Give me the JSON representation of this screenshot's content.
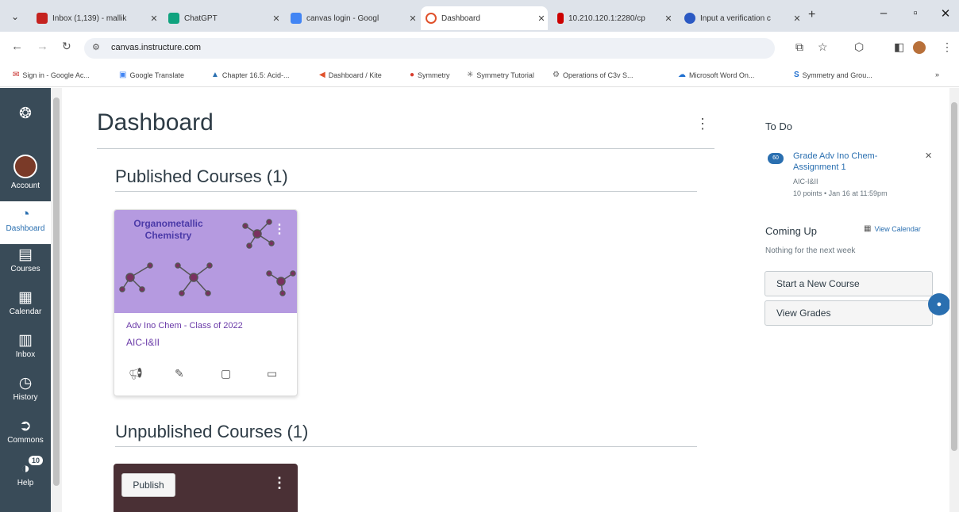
{
  "browser": {
    "tabs": [
      {
        "label": "Inbox (1,139) - mallik",
        "color": "#c5221f"
      },
      {
        "label": "ChatGPT",
        "color": "#10a37f"
      },
      {
        "label": "canvas login - Googl",
        "color": "#4285f4"
      },
      {
        "label": "Dashboard",
        "color": "#e0512b"
      },
      {
        "label": "10.210.120.1:2280/cp",
        "color": "#c00"
      },
      {
        "label": "Input a verification c",
        "color": "#2b59c3"
      }
    ],
    "new_tab": "+",
    "url": "canvas.instructure.com",
    "bookmarks": [
      "Sign in - Google Ac...",
      "Google Translate",
      "Chapter 16.5: Acid-...",
      "Dashboard / Kite",
      "Symmetry",
      "Symmetry Tutorial",
      "Operations of C3v S...",
      "Microsoft Word On...",
      "Symmetry and Grou..."
    ],
    "more_bookmarks": "»"
  },
  "global_nav": {
    "items": [
      {
        "label": "Account"
      },
      {
        "label": "Dashboard"
      },
      {
        "label": "Courses"
      },
      {
        "label": "Calendar"
      },
      {
        "label": "Inbox"
      },
      {
        "label": "History"
      },
      {
        "label": "Commons"
      },
      {
        "label": "Help",
        "badge": "10"
      }
    ]
  },
  "main": {
    "title": "Dashboard",
    "published_heading": "Published Courses (1)",
    "unpublished_heading": "Unpublished Courses (1)",
    "course_card": {
      "image_text": "Organometallic Chemistry",
      "title": "Adv Ino Chem - Class of 2022",
      "code": "AIC-I&II"
    },
    "unpublished_card": {
      "publish_label": "Publish"
    }
  },
  "sidebar": {
    "todo_heading": "To Do",
    "todo_item": {
      "badge": "60",
      "title": "Grade Adv Ino Chem- Assignment 1",
      "course": "AIC-I&II",
      "meta": "10 points • Jan 16 at 11:59pm"
    },
    "coming_up_heading": "Coming Up",
    "view_calendar": "View Calendar",
    "coming_up_empty": "Nothing for the next week",
    "start_course_button": "Start a New Course",
    "view_grades_button": "View Grades"
  }
}
